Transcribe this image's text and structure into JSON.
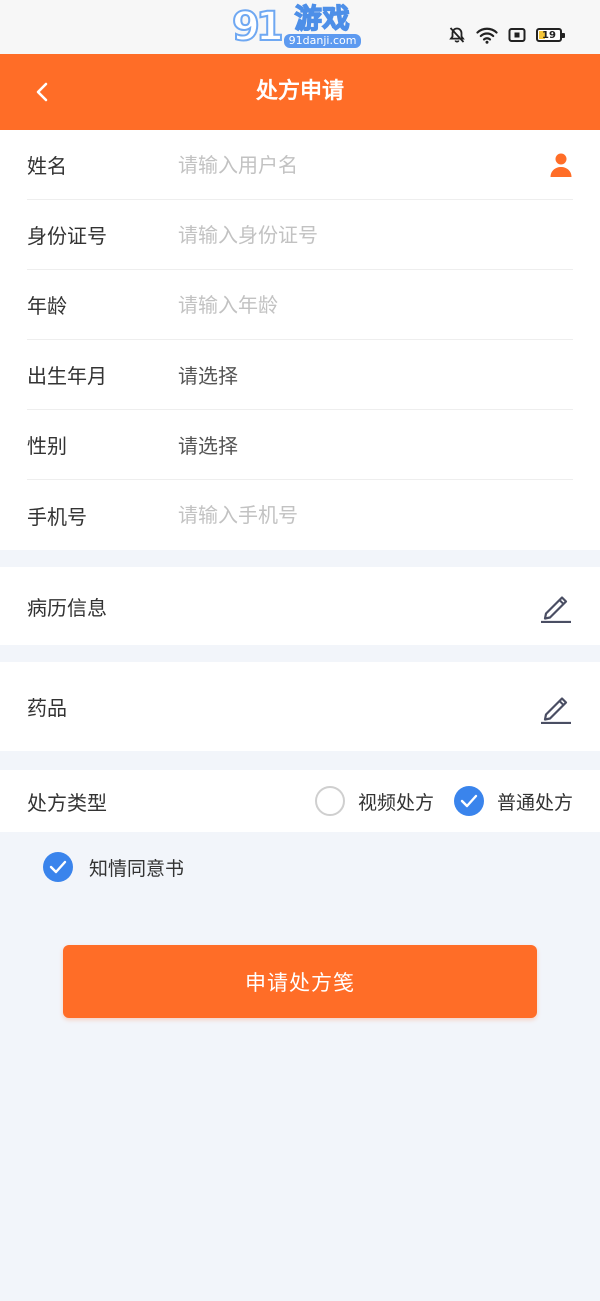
{
  "watermark": {
    "number": "91",
    "title": "游戏",
    "domain": "91danji.com"
  },
  "status_bar": {
    "battery_level": "19"
  },
  "navbar": {
    "title": "处方申请"
  },
  "form": {
    "name": {
      "label": "姓名",
      "placeholder": "请输入用户名"
    },
    "id_number": {
      "label": "身份证号",
      "placeholder": "请输入身份证号"
    },
    "age": {
      "label": "年龄",
      "placeholder": "请输入年龄"
    },
    "birth": {
      "label": "出生年月",
      "value": "请选择"
    },
    "gender": {
      "label": "性别",
      "value": "请选择"
    },
    "phone": {
      "label": "手机号",
      "placeholder": "请输入手机号"
    }
  },
  "medical_history": {
    "label": "病历信息"
  },
  "drugs": {
    "label": "药品"
  },
  "prescription_type": {
    "label": "处方类型",
    "options": [
      {
        "label": "视频处方",
        "checked": false
      },
      {
        "label": "普通处方",
        "checked": true
      }
    ]
  },
  "consent": {
    "label": "知情同意书",
    "checked": true
  },
  "submit": {
    "label": "申请处方笺"
  },
  "colors": {
    "brand": "#ff6d27",
    "accent": "#3a84ec",
    "background": "#f2f5fa"
  }
}
